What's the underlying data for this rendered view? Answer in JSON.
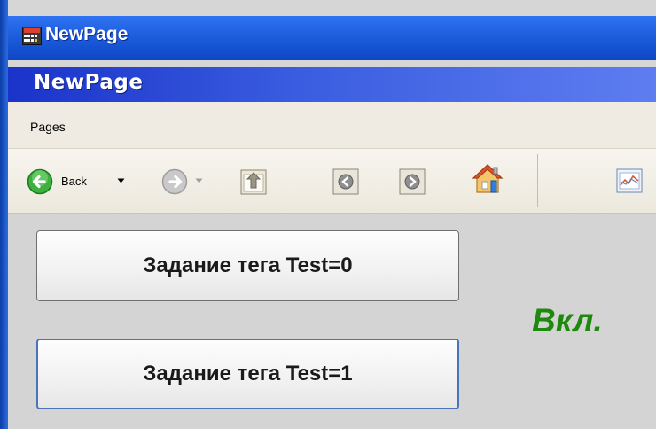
{
  "window": {
    "title": "NewPage"
  },
  "page": {
    "header": "NewPage"
  },
  "menu": {
    "items": [
      "Pages"
    ]
  },
  "toolbar": {
    "back_label": "Back"
  },
  "buttons": [
    {
      "label": "Задание тега Test=0"
    },
    {
      "label": "Задание тега Test=1"
    }
  ],
  "status": {
    "text": "Вкл.",
    "color": "#1e8a0d"
  }
}
